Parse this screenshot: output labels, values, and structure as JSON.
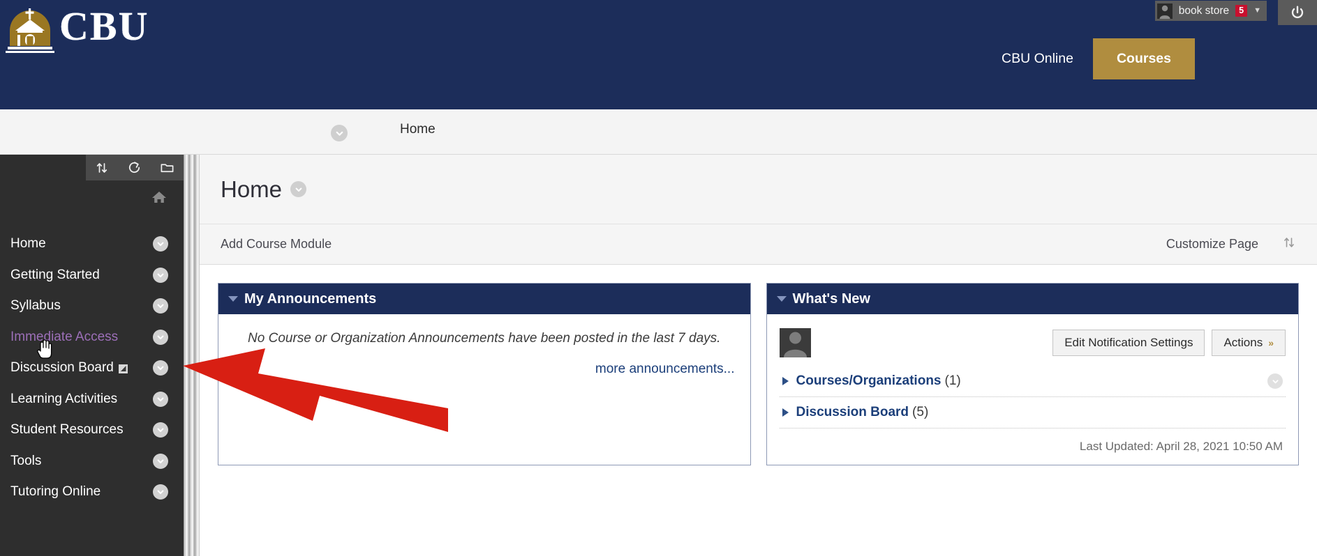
{
  "header": {
    "logo_text": "CBU",
    "logo_icon": "chapel-logo-icon",
    "user_menu": {
      "name": "book store",
      "badge": "5",
      "caret": "▼",
      "avatar_icon": "user-avatar-icon"
    },
    "power_icon": "power-icon",
    "tabs": [
      {
        "label": "CBU Online",
        "active": false
      },
      {
        "label": "Courses",
        "active": true
      }
    ]
  },
  "breadcrumb": {
    "toggle_icon": "chevron-down-icon",
    "path": "Home"
  },
  "sidebar": {
    "toolbar": [
      {
        "icon": "reorder-arrows-icon"
      },
      {
        "icon": "refresh-icon"
      },
      {
        "icon": "folder-icon"
      }
    ],
    "home_icon": "home-icon",
    "items": [
      {
        "label": "Home",
        "visited": false,
        "external": false
      },
      {
        "label": "Getting Started",
        "visited": false,
        "external": false
      },
      {
        "label": "Syllabus",
        "visited": false,
        "external": false
      },
      {
        "label": "Immediate Access",
        "visited": true,
        "external": false
      },
      {
        "label": "Discussion Board",
        "visited": false,
        "external": true
      },
      {
        "label": "Learning Activities",
        "visited": false,
        "external": false
      },
      {
        "label": "Student Resources",
        "visited": false,
        "external": false
      },
      {
        "label": "Tools",
        "visited": false,
        "external": false
      },
      {
        "label": "Tutoring Online",
        "visited": false,
        "external": false
      }
    ]
  },
  "main": {
    "page_title": "Home",
    "title_caret_icon": "chevron-down-icon",
    "action_bar": {
      "add_module_label": "Add Course Module",
      "customize_label": "Customize Page",
      "reorder_icon": "reorder-arrows-icon"
    },
    "announcements": {
      "title": "My Announcements",
      "collapse_icon": "triangle-down-icon",
      "empty_text": "No Course or Organization Announcements have been posted in the last 7 days.",
      "more_link": "more announcements..."
    },
    "whats_new": {
      "title": "What's New",
      "collapse_icon": "triangle-down-icon",
      "avatar_icon": "user-avatar-icon",
      "buttons": [
        {
          "label": "Edit Notification Settings",
          "has_chevron": false
        },
        {
          "label": "Actions",
          "has_chevron": true,
          "chevron": "»"
        }
      ],
      "items": [
        {
          "label": "Courses/Organizations",
          "count": "(1)",
          "has_caret": true
        },
        {
          "label": "Discussion Board",
          "count": "(5)",
          "has_caret": false
        }
      ],
      "last_updated": "Last Updated: April 28, 2021 10:50 AM"
    }
  },
  "annotation": {
    "arrow_icon": "red-arrow-pointing-left",
    "arrow_color": "#d81f13"
  },
  "colors": {
    "navy": "#1c2d5a",
    "gold": "#b08d3f",
    "sidebar_dark": "#2e2e2e",
    "visited_link": "#9c6fb8",
    "badge_red": "#c8102e",
    "link_blue": "#1c3f7a"
  }
}
